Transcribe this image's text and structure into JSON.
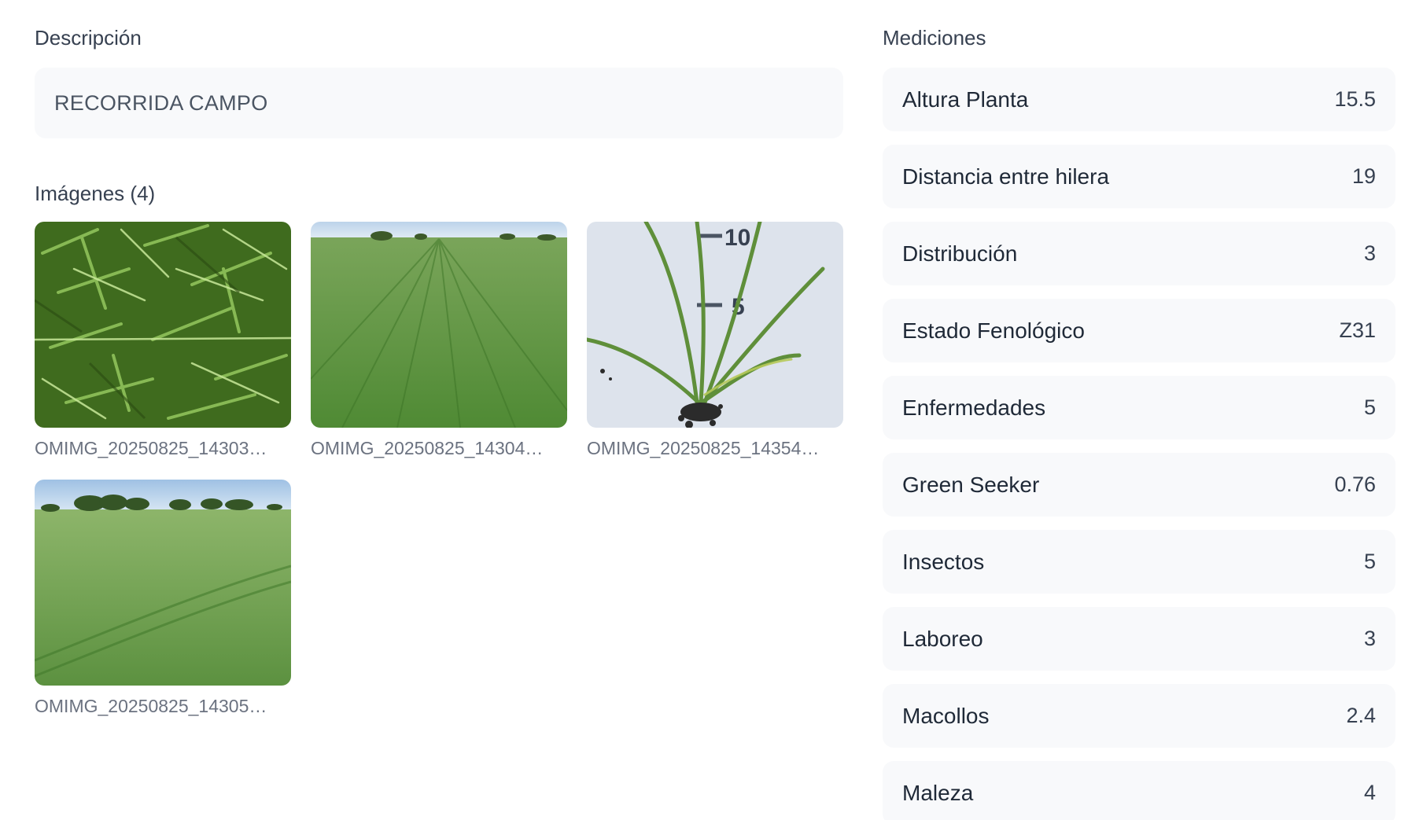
{
  "description": {
    "title": "Descripción",
    "value": "RECORRIDA CAMPO"
  },
  "images": {
    "title": "Imágenes (4)",
    "items": [
      {
        "name": "OMIMG_20250825_14303…",
        "icon": "wheat-closeup-photo"
      },
      {
        "name": "OMIMG_20250825_14304…",
        "icon": "field-horizon-photo"
      },
      {
        "name": "OMIMG_20250825_14354…",
        "icon": "plant-ruler-photo"
      },
      {
        "name": "OMIMG_20250825_14305…",
        "icon": "field-trees-photo"
      }
    ]
  },
  "measurements": {
    "title": "Mediciones",
    "items": [
      {
        "label": "Altura Planta",
        "value": "15.5"
      },
      {
        "label": "Distancia entre hilera",
        "value": "19"
      },
      {
        "label": "Distribución",
        "value": "3"
      },
      {
        "label": "Estado Fenológico",
        "value": "Z31"
      },
      {
        "label": "Enfermedades",
        "value": "5"
      },
      {
        "label": "Green Seeker",
        "value": "0.76"
      },
      {
        "label": "Insectos",
        "value": "5"
      },
      {
        "label": "Laboreo",
        "value": "3"
      },
      {
        "label": "Macollos",
        "value": "2.4"
      },
      {
        "label": "Maleza",
        "value": "4"
      }
    ]
  },
  "photo_labels": {
    "ruler_10": "10",
    "ruler_5": "5"
  }
}
